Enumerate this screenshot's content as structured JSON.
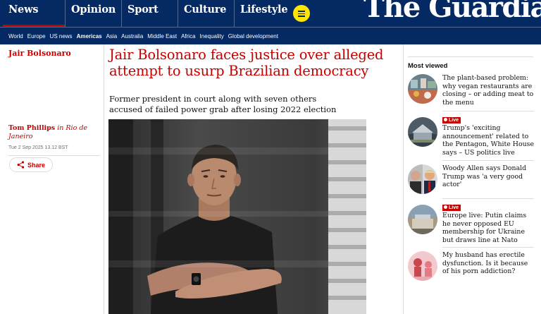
{
  "header": {
    "pillars": [
      "News",
      "Opinion",
      "Sport",
      "Culture",
      "Lifestyle"
    ],
    "active_pillar": "News",
    "logo": "The Guardian",
    "menu_icon": "hamburger-icon",
    "brand_color": "#052962",
    "accent_color": "#c70000",
    "menu_button_color": "#ffe500"
  },
  "subnav": {
    "items": [
      "World",
      "Europe",
      "US news",
      "Americas",
      "Asia",
      "Australia",
      "Middle East",
      "Africa",
      "Inequality",
      "Global development"
    ],
    "active": "Americas"
  },
  "meta": {
    "series": "Jair Bolsonaro",
    "author": "Tom Phillips",
    "location_prefix": "in",
    "location": "Rio de Janeiro",
    "dateline": "Tue 2 Sep 2025 13.12 BST",
    "share_label": "Share",
    "share_icon": "share-icon"
  },
  "article": {
    "headline": "Jair Bolsonaro faces justice over alleged attempt to usurp Brazilian democracy",
    "standfirst": "Former president in court along with seven others accused of failed power grab after losing 2022 election"
  },
  "most_viewed": {
    "title": "Most viewed",
    "live_label": "Live",
    "items": [
      {
        "live": false,
        "text": "The plant-based problem: why vegan restaurants are closing – or adding meat to the menu"
      },
      {
        "live": true,
        "text": "Trump's 'exciting announcement' related to the Pentagon, White House says – US politics live"
      },
      {
        "live": false,
        "text": "Woody Allen says Donald Trump was 'a very good actor'"
      },
      {
        "live": true,
        "text": "Europe live: Putin claims he never opposed EU membership for Ukraine but draws line at Nato"
      },
      {
        "live": false,
        "text": "My husband has erectile dysfunction. Is it because of his porn addiction?"
      }
    ]
  }
}
